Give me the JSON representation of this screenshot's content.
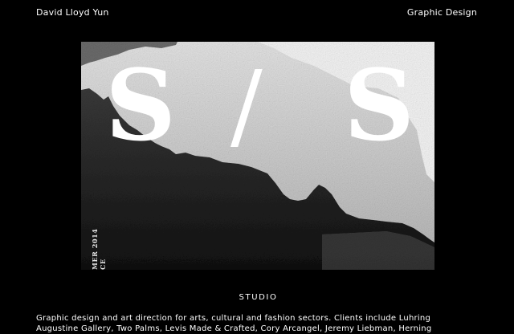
{
  "header": {
    "site_name": "David Lloyd Yun",
    "nav_link": "Graphic Design"
  },
  "hero": {
    "title_left": "S",
    "title_slash": "/",
    "title_right": "S",
    "caption_line1": "MER 2014",
    "caption_line2": "CE"
  },
  "section": {
    "heading": "STUDIO",
    "description_line1": "Graphic design and art direction for arts, cultural and fashion sectors. Clients include Luhring",
    "description_line2": "Augustine Gallery, Two Palms, Levis Made & Crafted, Cory Arcangel, Jeremy Liebman, Herning"
  },
  "colors": {
    "background": "#000000",
    "text": "#ffffff",
    "sky": "#cfcfcf",
    "mountain": "#2a2a2a"
  }
}
